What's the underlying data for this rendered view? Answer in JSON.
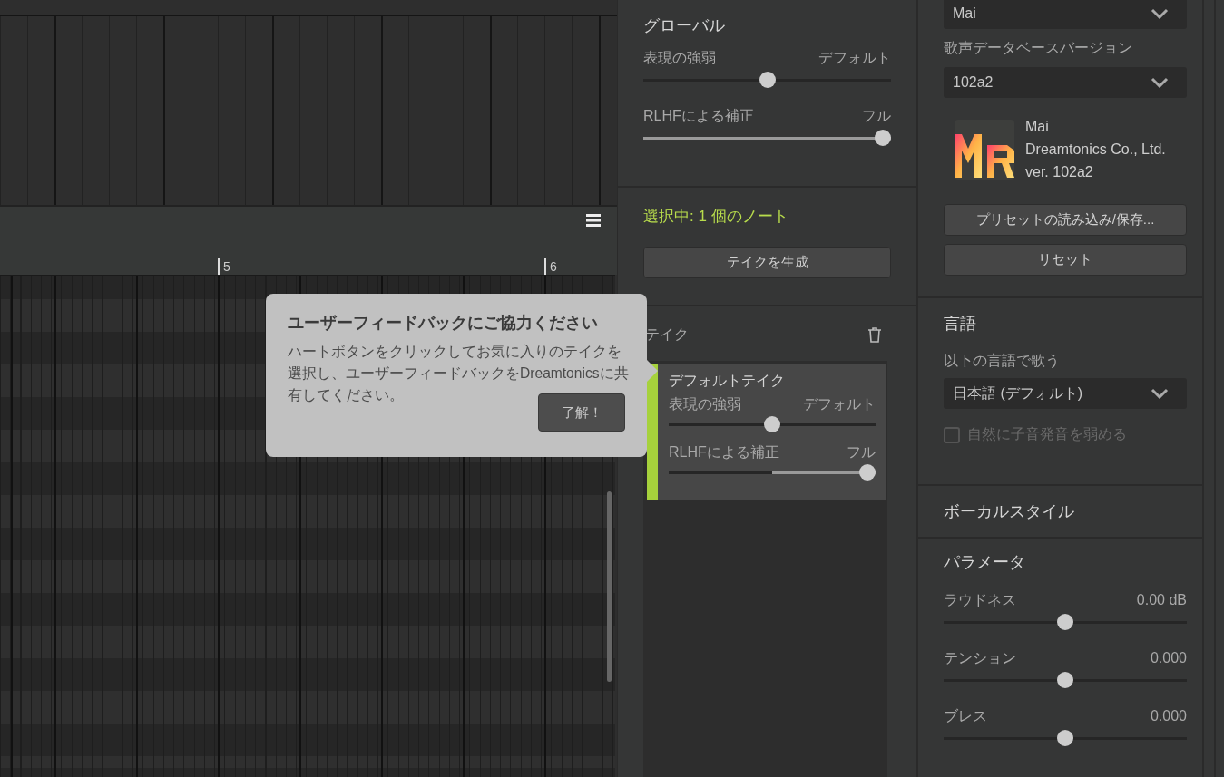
{
  "editor": {
    "ruler": [
      {
        "label": "5"
      },
      {
        "label": "6"
      }
    ]
  },
  "tooltip": {
    "title": "ユーザーフィードバックにご協力ください",
    "body": "ハートボタンをクリックしてお気に入りのテイクを選択し、ユーザーフィードバックをDreamtonicsに共有してください。",
    "button": "了解！"
  },
  "global_panel": {
    "title": "グローバル",
    "sliders": [
      {
        "label": "表現の強弱",
        "value": "デフォルト",
        "level": 0.5,
        "kind": "centered"
      },
      {
        "label": "RLHFによる補正",
        "value": "フル",
        "level": 1.0,
        "kind": "filled"
      }
    ]
  },
  "selection": {
    "text": "選択中: 1 個のノート",
    "button": "テイクを生成"
  },
  "takes": {
    "title": "テイク",
    "items": [
      {
        "name": "デフォルトテイク",
        "selected": true,
        "sliders": [
          {
            "label": "表現の強弱",
            "value": "デフォルト",
            "level": 0.5,
            "kind": "centered"
          },
          {
            "label": "RLHFによる補正",
            "value": "フル",
            "level": 1.0,
            "kind": "centered"
          }
        ]
      }
    ]
  },
  "voice": {
    "voice_dropdown": "Mai",
    "version_label": "歌声データベースバージョン",
    "version_dropdown": "102a2",
    "info": {
      "name": "Mai",
      "company": "Dreamtonics Co., Ltd.",
      "version": "ver. 102a2"
    },
    "buttons": [
      "プリセットの読み込み/保存...",
      "リセット"
    ]
  },
  "language": {
    "title": "言語",
    "label": "以下の言語で歌う",
    "dropdown": "日本語 (デフォルト)",
    "checkbox": {
      "label": "自然に子音発音を弱める",
      "checked": false,
      "disabled": true
    }
  },
  "vocal_style": {
    "title": "ボーカルスタイル"
  },
  "parameters": {
    "title": "パラメータ",
    "sliders": [
      {
        "label": "ラウドネス",
        "value": "0.00 dB",
        "level": 0.5,
        "kind": "centered"
      },
      {
        "label": "テンション",
        "value": "0.000",
        "level": 0.5,
        "kind": "centered"
      },
      {
        "label": "ブレス",
        "value": "0.000",
        "level": 0.5,
        "kind": "centered"
      }
    ]
  }
}
